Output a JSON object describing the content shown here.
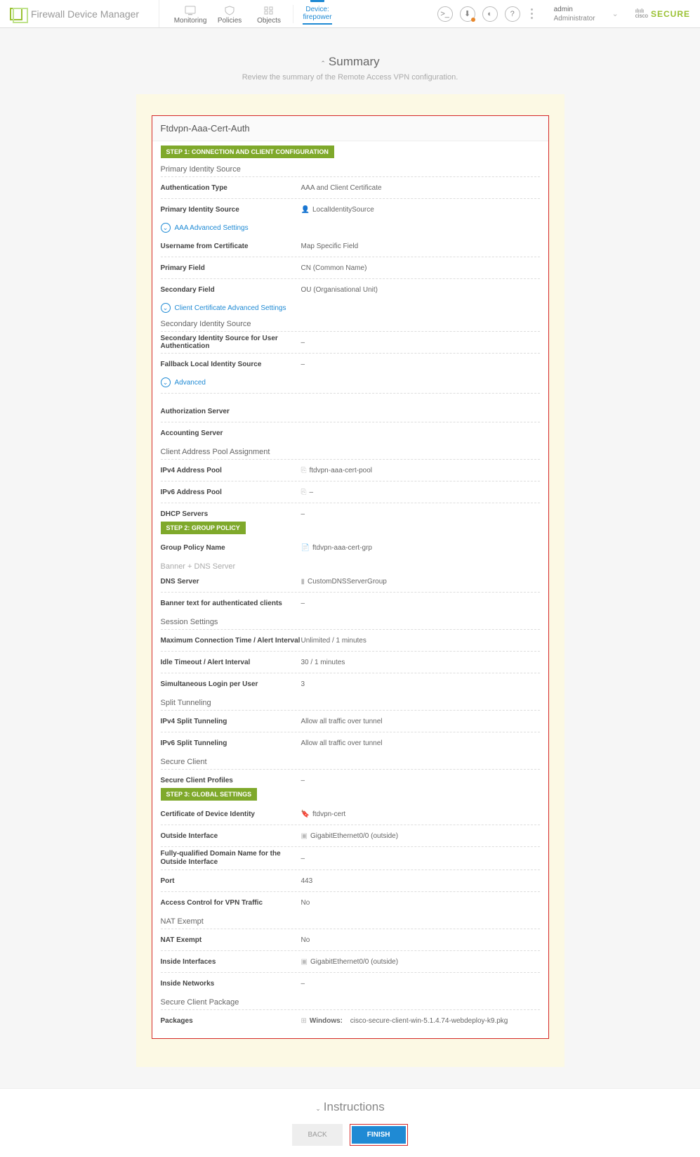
{
  "app": {
    "title": "Firewall Device Manager"
  },
  "nav": {
    "monitoring": "Monitoring",
    "policies": "Policies",
    "objects": "Objects",
    "device_top": "Device:",
    "device_name": "firepower"
  },
  "account": {
    "user": "admin",
    "role": "Administrator"
  },
  "brand": {
    "cisco": "cisco",
    "secure": "SECURE"
  },
  "summary": {
    "title": "Summary",
    "subtitle": "Review the summary of the Remote Access VPN configuration."
  },
  "panel": {
    "title": "Ftdvpn-Aaa-Cert-Auth"
  },
  "step1": {
    "badge": "STEP 1: CONNECTION AND CLIENT CONFIGURATION",
    "primary_identity": "Primary Identity Source",
    "auth_type_l": "Authentication Type",
    "auth_type_v": "AAA and Client Certificate",
    "pis_l": "Primary Identity Source",
    "pis_v": "LocalIdentitySource",
    "aaa_adv": "AAA Advanced Settings",
    "ufc_l": "Username from Certificate",
    "ufc_v": "Map Specific Field",
    "pf_l": "Primary Field",
    "pf_v": "CN (Common Name)",
    "sf_l": "Secondary Field",
    "sf_v": "OU (Organisational Unit)",
    "ccadv": "Client Certificate Advanced Settings",
    "sec_identity": "Secondary Identity Source",
    "sisua_l": "Secondary Identity Source for User Authentication",
    "sisua_v": "–",
    "flis_l": "Fallback Local Identity Source",
    "flis_v": "–",
    "adv": "Advanced",
    "authz_l": "Authorization Server",
    "acct_l": "Accounting Server",
    "capa": "Client Address Pool Assignment",
    "ip4_l": "IPv4 Address Pool",
    "ip4_v": "ftdvpn-aaa-cert-pool",
    "ip6_l": "IPv6 Address Pool",
    "ip6_v": "–",
    "dhcp_l": "DHCP Servers",
    "dhcp_v": "–"
  },
  "step2": {
    "badge": "STEP 2: GROUP POLICY",
    "gpn_l": "Group Policy Name",
    "gpn_v": "ftdvpn-aaa-cert-grp",
    "banner_dns": "Banner + DNS Server",
    "dns_l": "DNS Server",
    "dns_v": "CustomDNSServerGroup",
    "bt_l": "Banner text for authenticated clients",
    "bt_v": "–",
    "sess": "Session Settings",
    "mct_l": "Maximum Connection Time / Alert Interval",
    "mct_v": "Unlimited / 1 minutes",
    "it_l": "Idle Timeout / Alert Interval",
    "it_v": "30 / 1 minutes",
    "slpu_l": "Simultaneous Login per User",
    "slpu_v": "3",
    "st": "Split Tunneling",
    "ip4_l": "IPv4 Split Tunneling",
    "ip4_v": "Allow all traffic over tunnel",
    "ip6_l": "IPv6 Split Tunneling",
    "ip6_v": "Allow all traffic over tunnel",
    "sc": "Secure Client",
    "scp_l": "Secure Client Profiles",
    "scp_v": "–"
  },
  "step3": {
    "badge": "STEP 3: GLOBAL SETTINGS",
    "cdi_l": "Certificate of Device Identity",
    "cdi_v": "ftdvpn-cert",
    "oi_l": "Outside Interface",
    "oi_v": "GigabitEthernet0/0 (outside)",
    "fqdn_l": "Fully-qualified Domain Name for the Outside Interface",
    "fqdn_v": "–",
    "port_l": "Port",
    "port_v": "443",
    "ac_l": "Access Control for VPN Traffic",
    "ac_v": "No",
    "ne": "NAT Exempt",
    "nel_l": "NAT Exempt",
    "nel_v": "No",
    "ii_l": "Inside Interfaces",
    "ii_v": "GigabitEthernet0/0 (outside)",
    "in_l": "Inside Networks",
    "in_v": "–",
    "scp": "Secure Client Package",
    "pkg_l": "Packages",
    "pkg_os": "Windows:",
    "pkg_v": "cisco-secure-client-win-5.1.4.74-webdeploy-k9.pkg"
  },
  "footer": {
    "instructions": "Instructions",
    "back": "BACK",
    "finish": "FINISH"
  }
}
